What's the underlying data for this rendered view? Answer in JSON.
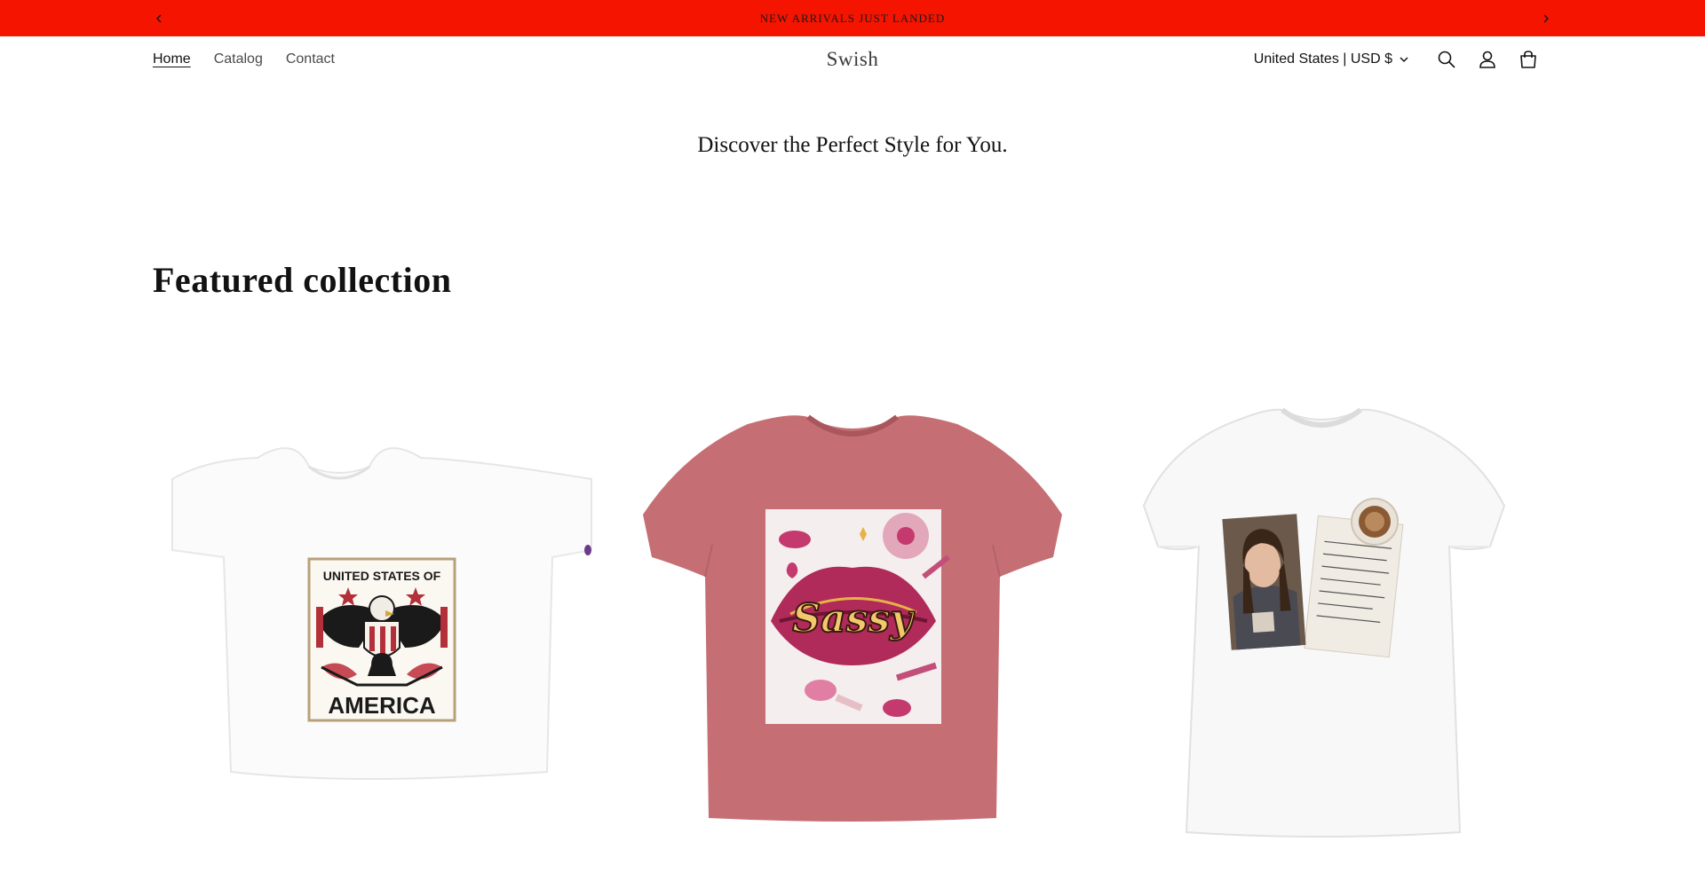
{
  "announcement": {
    "message": "NEW ARRIVALS JUST LANDED",
    "background": "#f51400"
  },
  "header": {
    "brand": "Swish",
    "nav": [
      {
        "label": "Home",
        "active": true
      },
      {
        "label": "Catalog",
        "active": false
      },
      {
        "label": "Contact",
        "active": false
      }
    ],
    "country_selector": "United States | USD $",
    "icons": [
      "search-icon",
      "account-icon",
      "cart-icon"
    ]
  },
  "hero": {
    "tagline": "Discover the Perfect Style for You."
  },
  "featured": {
    "title": "Featured collection",
    "products": [
      {
        "image": "white cropped tee with United States of America eagle crest",
        "design_text_top": "UNITED STATES OF",
        "design_text_bottom": "AMERICA",
        "color": "#ffffff"
      },
      {
        "image": "mauve tee with Sassy lips graphic",
        "design_text": "Sassy",
        "color": "#c56f74"
      },
      {
        "image": "white fitted tee with portrait and coffee note",
        "color": "#ffffff"
      }
    ]
  }
}
